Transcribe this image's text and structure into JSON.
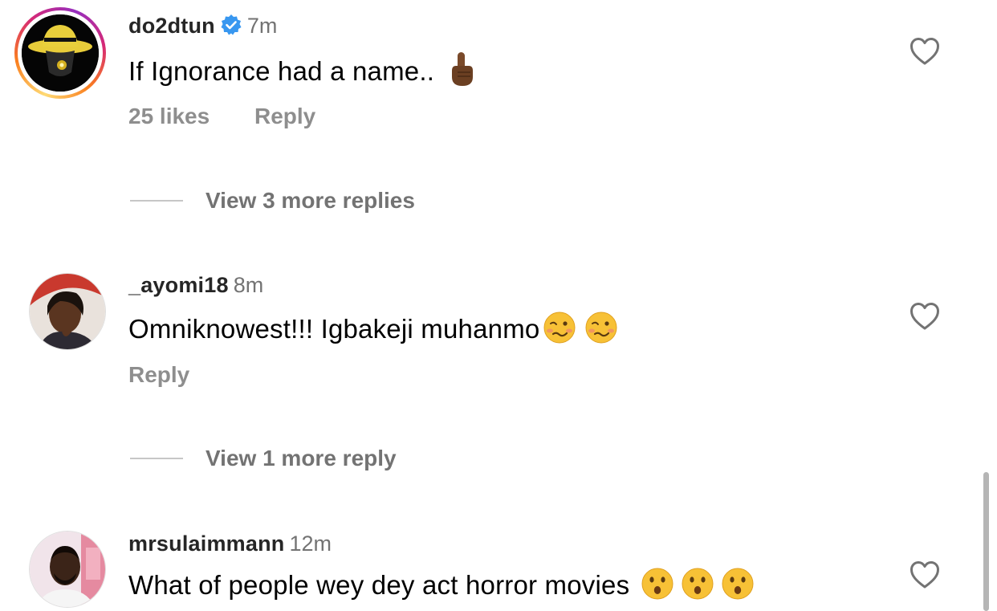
{
  "comments": [
    {
      "username": "do2dtun",
      "verified": true,
      "time": "7m",
      "text": "If Ignorance had a name..",
      "emoji": "pointing-up-dark-skin",
      "likes": "25 likes",
      "reply": "Reply",
      "view_more": "View 3 more replies",
      "avatar_ring": true
    },
    {
      "username": "_ayomi18",
      "verified": false,
      "time": "8m",
      "text": "Omniknowest!!! Igbakeji muhanmo",
      "emoji": "woozy-face",
      "reply": "Reply",
      "view_more": "View 1 more reply",
      "avatar_ring": false
    },
    {
      "username": "mrsulaimmann",
      "verified": false,
      "time": "12m",
      "text": "What of people wey dey act horror movies",
      "emoji": "hushed-face",
      "avatar_ring": false
    }
  ],
  "colors": {
    "username": "#262626",
    "muted": "#8e8e8e",
    "verified_blue": "#3897f0"
  }
}
